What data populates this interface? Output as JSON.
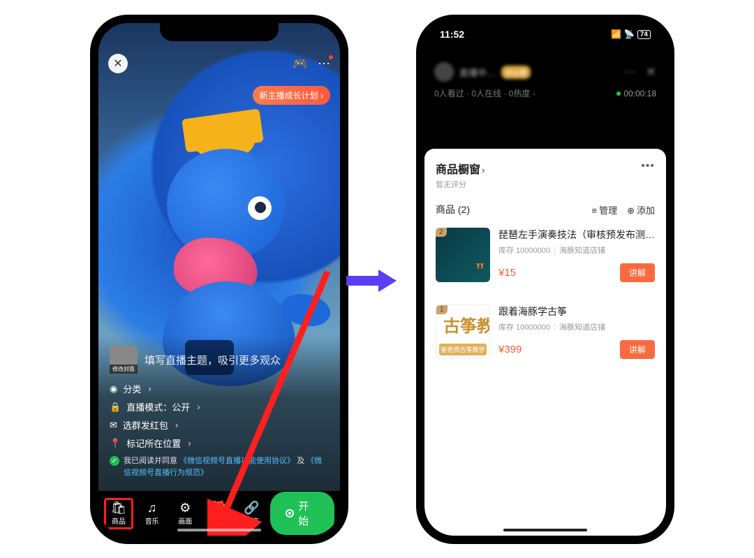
{
  "left": {
    "growth_pill": "新主播成长计划 ›",
    "cover_label": "修改封面",
    "title_placeholder": "填写直播主题，吸引更多观众",
    "lines": {
      "category_label": "分类",
      "mode_label": "直播模式：",
      "mode_value": "公开",
      "redpacket": "选群发红包",
      "location": "标记所在位置"
    },
    "consent_prefix": "我已阅读并同意",
    "consent_link1": "《微信视频号直播功能使用协议》",
    "consent_mid": "及",
    "consent_link2": "《微信视频号直播行为规范》",
    "bottom": {
      "items": [
        {
          "icon": "🛍",
          "label": "商品"
        },
        {
          "icon": "♫",
          "label": "音乐"
        },
        {
          "icon": "⚙",
          "label": "画面"
        },
        {
          "icon": "🎁",
          "label": "抽奖"
        },
        {
          "icon": "🔗",
          "label": "链接"
        }
      ],
      "start": "开始"
    }
  },
  "right": {
    "status": {
      "time": "11:52",
      "battery": "74"
    },
    "header": {
      "streamer": "直播中…",
      "badge": "拼台赛",
      "stats": "0人看过 · 0人在线 · 0热度",
      "timer": "00:00:18"
    },
    "sheet": {
      "title": "商品橱窗",
      "subtitle": "暂无评分",
      "count_label": "商品 (2)",
      "manage": "管理",
      "add": "添加",
      "products": [
        {
          "num": "2",
          "title": "琵琶左手演奏技法（审核预发布测…",
          "stock": "库存 10000000",
          "shop": "海豚知道店铺",
          "price": "¥15",
          "btn": "讲解"
        },
        {
          "num": "1",
          "thumb_big": "古筝教",
          "thumb_small": "崔老师古筝教学",
          "title": "跟着海豚学古筝",
          "stock": "库存 10000000",
          "shop": "海豚知道店铺",
          "price": "¥399",
          "btn": "讲解"
        }
      ]
    }
  }
}
